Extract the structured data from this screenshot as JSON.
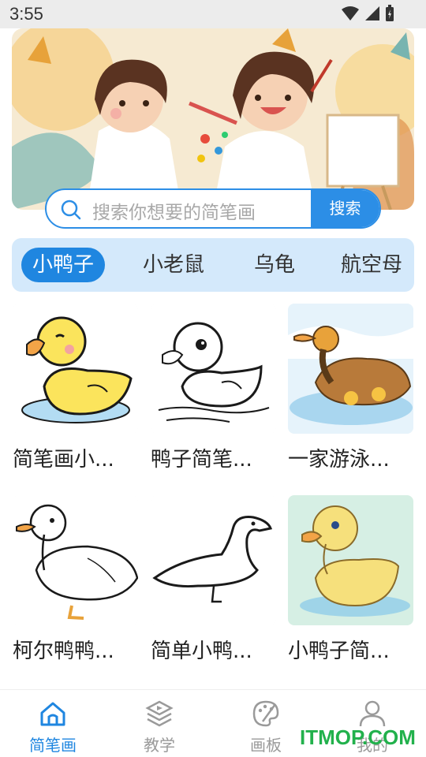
{
  "status_bar": {
    "time": "3:55"
  },
  "search": {
    "placeholder": "搜索你想要的简笔画",
    "button_label": "搜索"
  },
  "categories": [
    {
      "label": "小鸭子",
      "active": true
    },
    {
      "label": "小老鼠",
      "active": false
    },
    {
      "label": "乌龟",
      "active": false
    },
    {
      "label": "航空母",
      "active": false
    }
  ],
  "cards": [
    {
      "title": "简笔画小..."
    },
    {
      "title": "鸭子简笔..."
    },
    {
      "title": "一家游泳..."
    },
    {
      "title": "柯尔鸭鸭..."
    },
    {
      "title": "简单小鸭..."
    },
    {
      "title": "小鸭子简..."
    }
  ],
  "bottom_nav": [
    {
      "label": "简笔画",
      "icon": "home-icon",
      "active": true
    },
    {
      "label": "教学",
      "icon": "layers-play-icon",
      "active": false
    },
    {
      "label": "画板",
      "icon": "palette-icon",
      "active": false
    },
    {
      "label": "我的",
      "icon": "user-icon",
      "active": false
    }
  ],
  "watermark": "ITMOP.COM",
  "colors": {
    "accent": "#1f86e0",
    "category_bg": "#d4e9fb",
    "watermark": "#22b14c"
  }
}
